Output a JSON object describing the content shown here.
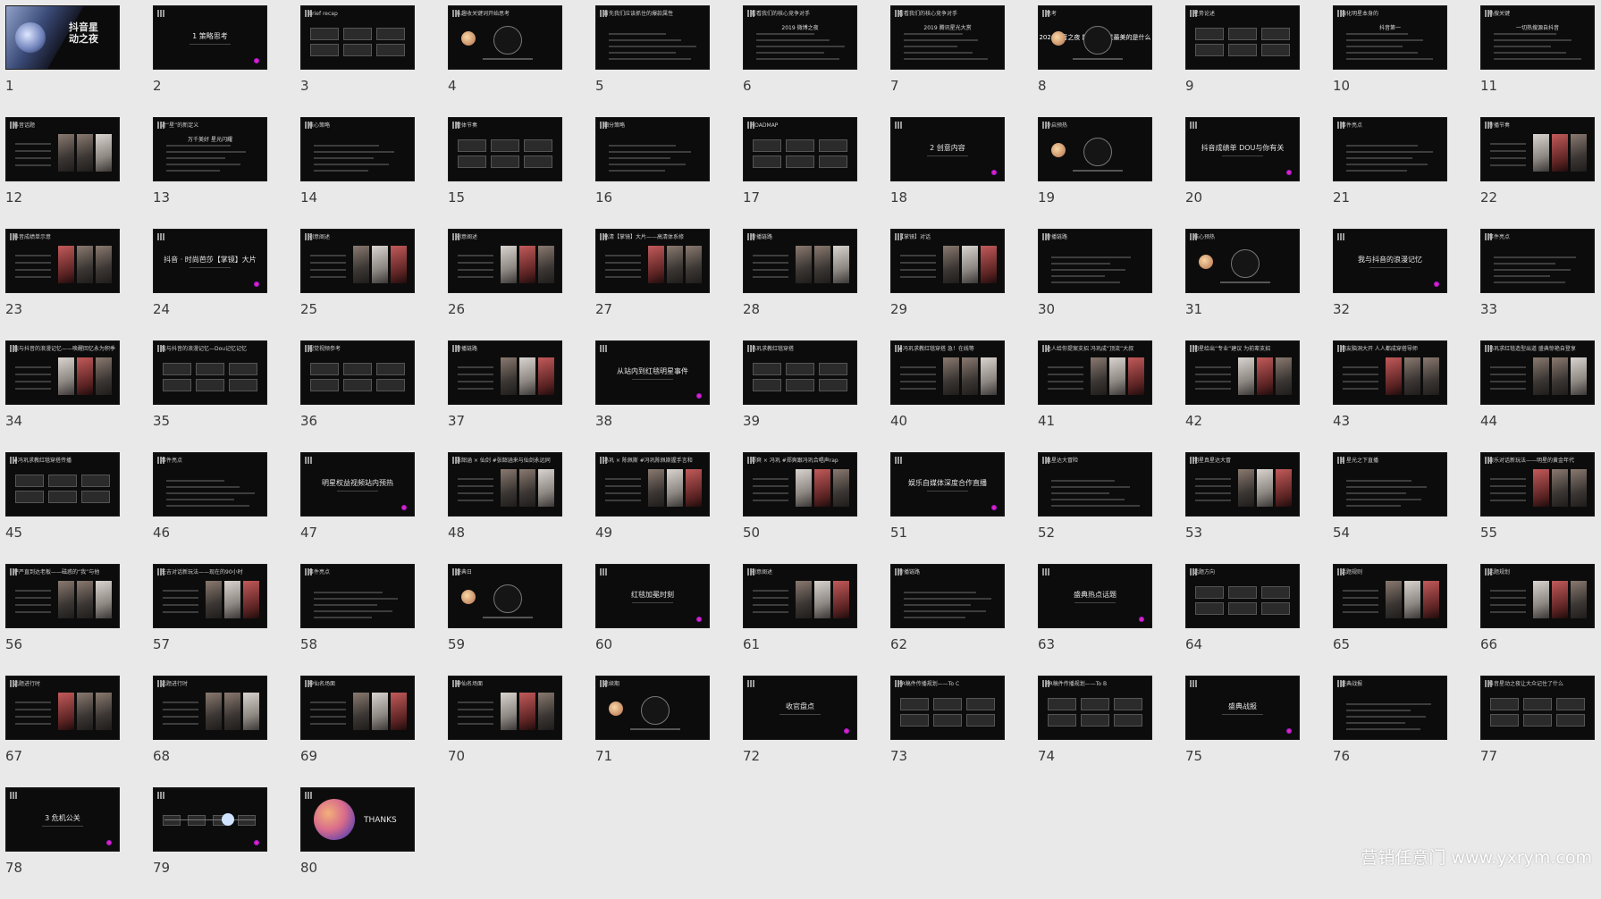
{
  "watermark": "营销任意门 www.yxrym.com",
  "colors": {
    "page_bg": "#e9e9e9",
    "slide_bg": "#0c0c0c",
    "number": "#3a3a3a",
    "accent_red": "#e5322d"
  },
  "slides": [
    {
      "n": "1",
      "type": "cover",
      "title": "抖音星动之夜"
    },
    {
      "n": "2",
      "type": "section",
      "title": "1 策略思考"
    },
    {
      "n": "3",
      "type": "boxes",
      "title": "Brief recap"
    },
    {
      "n": "4",
      "type": "circle",
      "title": "从趣收关键词开始思考",
      "center": "首届"
    },
    {
      "n": "5",
      "type": "list",
      "title": "首先我们应该抓住的爆款属性"
    },
    {
      "n": "6",
      "type": "list",
      "title": "看看我们的核心竞争对手",
      "sub": "2019 微博之夜"
    },
    {
      "n": "7",
      "type": "list",
      "title": "看看我们的核心竞争对手",
      "sub": "2019 腾讯星光大赏"
    },
    {
      "n": "8",
      "type": "circle",
      "title": "思考",
      "center": "2020抖音之夜 能真给明星最美的是什么"
    },
    {
      "n": "9",
      "type": "boxes",
      "title": "星势论述"
    },
    {
      "n": "10",
      "type": "list",
      "title": "强化明星本身的",
      "sub": "抖音第一"
    },
    {
      "n": "11",
      "type": "list",
      "title": "热搜关键",
      "sub": "一切热搜源自抖音"
    },
    {
      "n": "12",
      "type": "photos",
      "title": "抖音话题"
    },
    {
      "n": "13",
      "type": "list",
      "title": "对“星”的新定义",
      "sub": "万千美好  星光闪耀"
    },
    {
      "n": "14",
      "type": "list",
      "title": "核心策略"
    },
    {
      "n": "15",
      "type": "boxes",
      "title": "整体节奏"
    },
    {
      "n": "16",
      "type": "list",
      "title": "细分策略"
    },
    {
      "n": "17",
      "type": "boxes",
      "title": "ROADMAP"
    },
    {
      "n": "18",
      "type": "section",
      "title": "2 创意内容"
    },
    {
      "n": "19",
      "type": "circle",
      "title": "冷启预热"
    },
    {
      "n": "20",
      "type": "section",
      "title": "抖音成绩单 DOU与你有关"
    },
    {
      "n": "21",
      "type": "list",
      "title": "事件亮点"
    },
    {
      "n": "22",
      "type": "photos",
      "title": "传播节奏"
    },
    {
      "n": "23",
      "type": "photos",
      "title": "抖音成绩单示意"
    },
    {
      "n": "24",
      "type": "section",
      "title": "抖音 · 时尚芭莎【掌镜】大片"
    },
    {
      "n": "25",
      "type": "photos",
      "title": "创意阐述"
    },
    {
      "n": "26",
      "type": "photos",
      "title": "创意阐述"
    },
    {
      "n": "27",
      "type": "photos",
      "title": "高清【掌镜】大片——高清体系修"
    },
    {
      "n": "28",
      "type": "photos",
      "title": "传播链路"
    },
    {
      "n": "29",
      "type": "photos",
      "title": "【掌镜】对话"
    },
    {
      "n": "30",
      "type": "list",
      "title": "传播链路"
    },
    {
      "n": "31",
      "type": "circle",
      "title": "核心预热"
    },
    {
      "n": "32",
      "type": "section",
      "title": "我与抖音的浪漫记忆"
    },
    {
      "n": "33",
      "type": "list",
      "title": "事件亮点"
    },
    {
      "n": "34",
      "type": "photos",
      "title": "我与抖音的浪漫记忆——唤醒回忆永为积季"
    },
    {
      "n": "35",
      "type": "boxes",
      "title": "我与抖音的浪漫记忆—Dou记忆记忆"
    },
    {
      "n": "36",
      "type": "boxes",
      "title": "视觉视频参考"
    },
    {
      "n": "37",
      "type": "photos",
      "title": "传播链路"
    },
    {
      "n": "38",
      "type": "section",
      "title": "从站内到红毯明星事件"
    },
    {
      "n": "39",
      "type": "boxes",
      "title": "冯巩求教红毯穿搭"
    },
    {
      "n": "40",
      "type": "photos",
      "title": "#冯巩求教红毯穿搭 急！在线等"
    },
    {
      "n": "41",
      "type": "photos",
      "title": "达人给你提案支招 冯巩成“顶流”大叔"
    },
    {
      "n": "42",
      "type": "photos",
      "title": "明星给出“专业”建议 为前辈支招"
    },
    {
      "n": "43",
      "type": "photos",
      "title": "网友脑洞大开 人人都成穿搭导师"
    },
    {
      "n": "44",
      "type": "photos",
      "title": "冯巩求红毯造型出道 盛典惊艳自登享"
    },
    {
      "n": "45",
      "type": "boxes",
      "title": "#冯巩求教红毯穿搭传播"
    },
    {
      "n": "46",
      "type": "list",
      "title": "事件亮点"
    },
    {
      "n": "47",
      "type": "section",
      "title": "明星权益视频站内预热"
    },
    {
      "n": "48",
      "type": "photos",
      "title": "张韶涵 × 仙剑 #张韶涵来与仙剑永远同"
    },
    {
      "n": "49",
      "type": "photos",
      "title": "冯巩 × 陈佩斯 #冯巩陈佩斯握手言和"
    },
    {
      "n": "50",
      "type": "photos",
      "title": "郑爽 × 冯巩 #郑爽跟冯巩合唱声rap"
    },
    {
      "n": "51",
      "type": "section",
      "title": "娱乐自媒体深度合作直播"
    },
    {
      "n": "52",
      "type": "list",
      "title": "真星达大冒险"
    },
    {
      "n": "53",
      "type": "photos",
      "title": "明星真星达大冒"
    },
    {
      "n": "54",
      "type": "list",
      "title": "B 星光之下直播"
    },
    {
      "n": "55",
      "type": "photos",
      "title": "娱乐对话新玩法——明星的黄金年代"
    },
    {
      "n": "56",
      "type": "photos",
      "title": "萨严直到达老板——磁惑的“我”与他"
    },
    {
      "n": "57",
      "type": "photos",
      "title": "先吉对话新玩法——现在的90小时"
    },
    {
      "n": "58",
      "type": "list",
      "title": "事件亮点"
    },
    {
      "n": "59",
      "type": "circle",
      "title": "盛典日"
    },
    {
      "n": "60",
      "type": "section",
      "title": "红毯加冕时刻"
    },
    {
      "n": "61",
      "type": "photos",
      "title": "创意阐述"
    },
    {
      "n": "62",
      "type": "list",
      "title": "传播链路"
    },
    {
      "n": "63",
      "type": "section",
      "title": "盛典热点话题"
    },
    {
      "n": "64",
      "type": "boxes",
      "title": "话题方向"
    },
    {
      "n": "65",
      "type": "photos",
      "title": "话题规则"
    },
    {
      "n": "66",
      "type": "photos",
      "title": "话题规划"
    },
    {
      "n": "67",
      "type": "photos",
      "title": "话题进行时"
    },
    {
      "n": "68",
      "type": "photos",
      "title": "话题进行时"
    },
    {
      "n": "69",
      "type": "photos",
      "title": "神仙名场面"
    },
    {
      "n": "70",
      "type": "photos",
      "title": "神仙名场面"
    },
    {
      "n": "71",
      "type": "circle",
      "title": "延续期"
    },
    {
      "n": "72",
      "type": "section",
      "title": "收官盘点"
    },
    {
      "n": "73",
      "type": "boxes",
      "title": "PR稿件传播规划——To C"
    },
    {
      "n": "74",
      "type": "boxes",
      "title": "PR稿件传播规划——To B"
    },
    {
      "n": "75",
      "type": "section",
      "title": "盛典战报"
    },
    {
      "n": "76",
      "type": "list",
      "title": "盛典战报"
    },
    {
      "n": "77",
      "type": "boxes",
      "title": "抖音星动之夜让大众记住了什么"
    },
    {
      "n": "78",
      "type": "section",
      "title": "3 危机公关"
    },
    {
      "n": "79",
      "type": "flow",
      "title": ""
    },
    {
      "n": "80",
      "type": "thanks",
      "title": "THANKS"
    }
  ]
}
